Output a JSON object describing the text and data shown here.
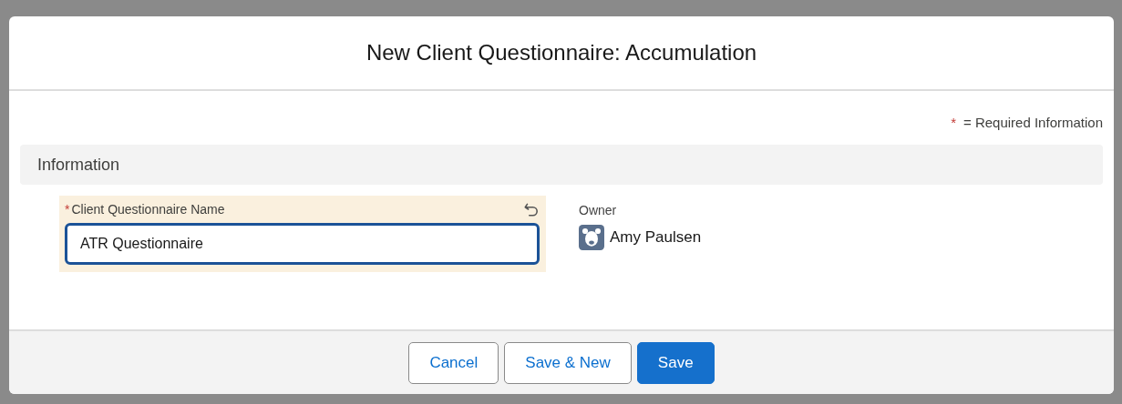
{
  "modal": {
    "title": "New Client Questionnaire: Accumulation"
  },
  "required_note": {
    "mark": "*",
    "text": "= Required Information"
  },
  "section": {
    "title": "Information"
  },
  "fields": [
    {
      "kind": "input",
      "required": true,
      "label": "Client Questionnaire Name",
      "value": "ATR Questionnaire",
      "changed": true
    },
    {
      "kind": "owner",
      "required": false,
      "label": "Owner",
      "value": "Amy Paulsen"
    }
  ],
  "buttons": [
    {
      "label": "Cancel",
      "kind": "neutral"
    },
    {
      "label": "Save & New",
      "kind": "neutral"
    },
    {
      "label": "Save",
      "kind": "brand"
    }
  ]
}
